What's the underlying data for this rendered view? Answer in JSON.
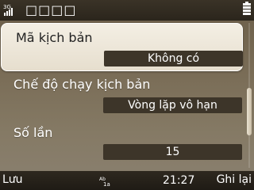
{
  "status_bar": {
    "title": "□□□□",
    "app_icon": "signal-icon",
    "battery_icon": "battery-icon"
  },
  "settings": [
    {
      "label": "Mã kịch bản",
      "value": "Không có"
    },
    {
      "label": "Chế độ chạy kịch bản",
      "value": "Vòng lặp vô hạn"
    },
    {
      "label": "Số lần",
      "value": "15"
    }
  ],
  "softkeys": {
    "left": "Lưu",
    "right": "Ghi lại",
    "clock": "21:27",
    "middle_icon": "input-mode-icon"
  },
  "colors": {
    "background": "#7a6d57",
    "selected_row": "#efe8da",
    "value_box": "#3d3529"
  }
}
